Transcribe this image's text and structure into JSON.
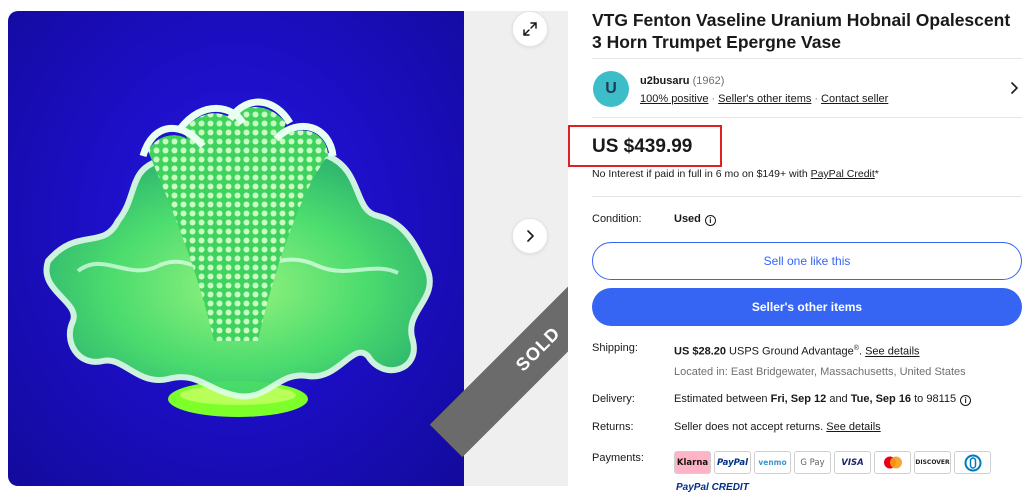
{
  "gallery": {
    "sold_label": "SOLD",
    "expand_icon": "expand-icon",
    "next_icon": "chevron-right-icon"
  },
  "listing": {
    "title": "VTG Fenton Vaseline Uranium Hobnail Opalescent 3 Horn Trumpet Epergne Vase"
  },
  "seller": {
    "avatar_letter": "U",
    "name": "u2busaru",
    "score": "(1962)",
    "positive": "100% positive",
    "other_items_link": "Seller's other items",
    "contact_link": "Contact seller"
  },
  "price": {
    "amount": "US $439.99",
    "financing_prefix": "No Interest if paid in full in 6 mo on $149+ with ",
    "financing_link": "PayPal Credit",
    "financing_suffix": "*"
  },
  "condition": {
    "label": "Condition:",
    "value": "Used"
  },
  "buttons": {
    "sell_like_this": "Sell one like this",
    "sellers_other_items": "Seller's other items"
  },
  "shipping": {
    "label": "Shipping:",
    "cost": "US $28.20",
    "service": " USPS Ground Advantage",
    "reg": "®",
    "details_link": "See details",
    "location": "Located in: East Bridgewater, Massachusetts, United States"
  },
  "delivery": {
    "label": "Delivery:",
    "prefix": "Estimated between ",
    "start": "Fri, Sep 12",
    "middle": " and ",
    "end": "Tue, Sep 16",
    "to": " to 98115"
  },
  "returns": {
    "label": "Returns:",
    "text": "Seller does not accept returns. ",
    "details_link": "See details"
  },
  "payments": {
    "label": "Payments:",
    "methods": [
      "Klarna",
      "PayPal",
      "venmo",
      "G Pay",
      "VISA",
      "Mastercard",
      "DISCOVER",
      "Diners"
    ],
    "paypal_credit": "PayPal CREDIT"
  },
  "colors": {
    "accent": "#3665f3",
    "highlight_box": "#e02020",
    "avatar": "#3dbdc7",
    "photo_bg": "#1c0fc6",
    "glass": "#59f06a"
  }
}
